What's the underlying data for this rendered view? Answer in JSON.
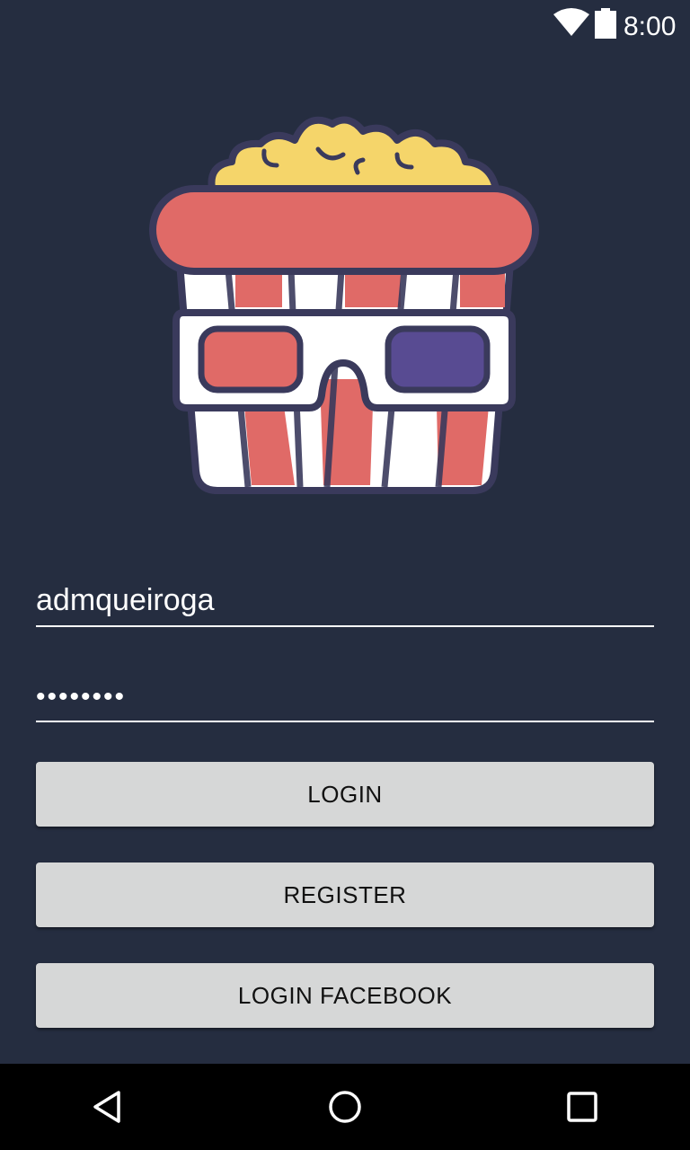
{
  "status_bar": {
    "time": "8:00",
    "icons": [
      "wifi-icon",
      "battery-icon"
    ]
  },
  "logo": {
    "icon": "popcorn-3d-glasses-logo",
    "colors": {
      "popcorn": "#f5d56a",
      "red": "#e06a67",
      "white": "#ffffff",
      "outline": "#3a3a5c",
      "blue_lens": "#584b92"
    }
  },
  "form": {
    "username_value": "admqueiroga",
    "password_value": "••••••••"
  },
  "buttons": {
    "login_label": "LOGIN",
    "register_label": "REGISTER",
    "facebook_label": "LOGIN FACEBOOK"
  },
  "nav_bar": {
    "icons": [
      "back-icon",
      "home-icon",
      "recent-apps-icon"
    ]
  },
  "colors": {
    "background": "#252d40",
    "button": "#d6d7d7"
  }
}
